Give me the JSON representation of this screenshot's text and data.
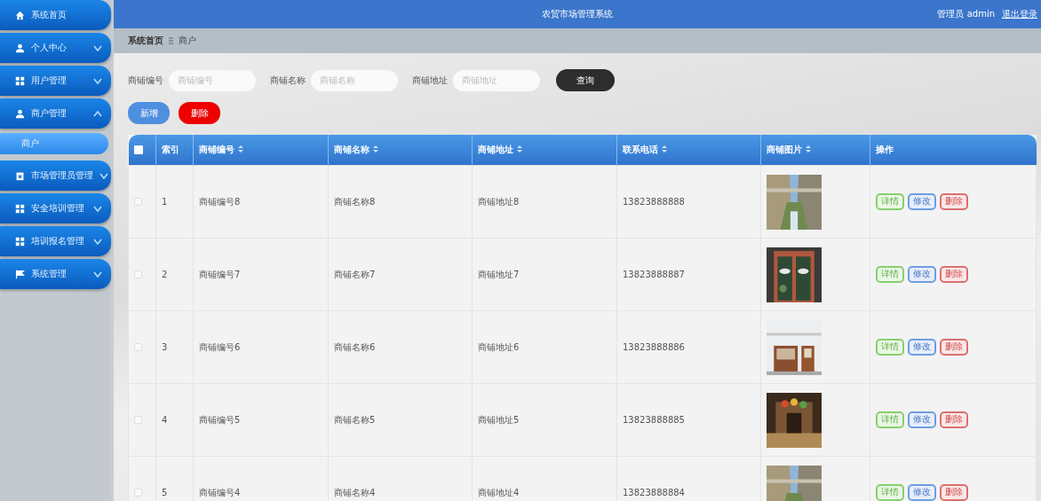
{
  "header": {
    "title": "农贸市场管理系统",
    "user": "管理员 admin",
    "logout": "退出登录"
  },
  "sidebar": {
    "items": [
      {
        "label": "系统首页"
      },
      {
        "label": "个人中心",
        "expanded": false
      },
      {
        "label": "用户管理",
        "expanded": false
      },
      {
        "label": "商户管理",
        "expanded": true,
        "children": [
          {
            "label": "商户",
            "selected": true
          }
        ]
      },
      {
        "label": "市场管理员管理",
        "expanded": false
      },
      {
        "label": "安全培训管理",
        "expanded": false
      },
      {
        "label": "培训报名管理",
        "expanded": false
      },
      {
        "label": "系统管理",
        "expanded": false
      }
    ]
  },
  "breadcrumb": [
    "系统首页",
    "商户"
  ],
  "search": {
    "fields": [
      {
        "label": "商铺编号",
        "placeholder": "商铺编号"
      },
      {
        "label": "商铺名称",
        "placeholder": "商铺名称"
      },
      {
        "label": "商铺地址",
        "placeholder": "商铺地址"
      }
    ],
    "button": "查询"
  },
  "actions": [
    {
      "label": "新增",
      "kind": "add"
    },
    {
      "label": "删除",
      "kind": "delete"
    }
  ],
  "table": {
    "select_all": false,
    "columns": [
      {
        "label": "索引",
        "sortable": false
      },
      {
        "label": "商铺编号",
        "sortable": true
      },
      {
        "label": "商铺名称",
        "sortable": true
      },
      {
        "label": "商铺地址",
        "sortable": true
      },
      {
        "label": "联系电话",
        "sortable": true
      },
      {
        "label": "商铺图片",
        "sortable": true
      },
      {
        "label": "操作",
        "sortable": false
      }
    ],
    "rows": [
      {
        "checked": false,
        "index": "1",
        "code": "商铺编号8",
        "name": "商铺名称8",
        "address": "商铺地址8",
        "phone": "13823888888",
        "actions": [
          {
            "label": "详情",
            "kind": "detail"
          },
          {
            "label": "修改",
            "kind": "edit"
          },
          {
            "label": "删除",
            "kind": "delete"
          }
        ]
      },
      {
        "checked": false,
        "index": "2",
        "code": "商铺编号7",
        "name": "商铺名称7",
        "address": "商铺地址7",
        "phone": "13823888887",
        "actions": [
          {
            "label": "详情",
            "kind": "detail"
          },
          {
            "label": "修改",
            "kind": "edit"
          },
          {
            "label": "删除",
            "kind": "delete"
          }
        ]
      },
      {
        "checked": false,
        "index": "3",
        "code": "商铺编号6",
        "name": "商铺名称6",
        "address": "商铺地址6",
        "phone": "13823888886",
        "actions": [
          {
            "label": "详情",
            "kind": "detail"
          },
          {
            "label": "修改",
            "kind": "edit"
          },
          {
            "label": "删除",
            "kind": "delete"
          }
        ]
      },
      {
        "checked": false,
        "index": "4",
        "code": "商铺编号5",
        "name": "商铺名称5",
        "address": "商铺地址5",
        "phone": "13823888885",
        "actions": [
          {
            "label": "详情",
            "kind": "detail"
          },
          {
            "label": "修改",
            "kind": "edit"
          },
          {
            "label": "删除",
            "kind": "delete"
          }
        ]
      },
      {
        "checked": false,
        "index": "5",
        "code": "商铺编号4",
        "name": "商铺名称4",
        "address": "商铺地址4",
        "phone": "13823888884",
        "actions": [
          {
            "label": "详情",
            "kind": "detail"
          },
          {
            "label": "修改",
            "kind": "edit"
          },
          {
            "label": "删除",
            "kind": "delete"
          }
        ]
      }
    ]
  }
}
